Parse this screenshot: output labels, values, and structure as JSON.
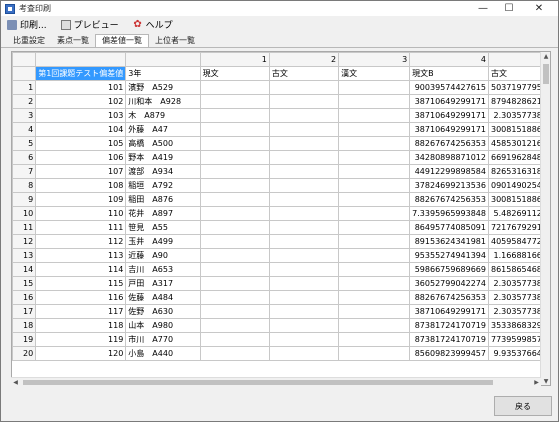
{
  "window": {
    "title": "考査印刷"
  },
  "toolbar": {
    "print_label": "印刷...",
    "preview_label": "プレビュー",
    "help_label": "ヘルプ"
  },
  "tabs": [
    {
      "label": "比重設定"
    },
    {
      "label": "素点一覧"
    },
    {
      "label": "偏差値一覧"
    },
    {
      "label": "上位者一覧"
    }
  ],
  "active_tab_index": 2,
  "grid": {
    "column_numbers": [
      "",
      "1",
      "2",
      "3",
      "4",
      ""
    ],
    "header_row": [
      "第1回課題テスト偏差値",
      "3年",
      "現文",
      "古文",
      "漢文",
      "現文B",
      "古文"
    ],
    "rows": [
      {
        "row": "1",
        "no": "101",
        "name": "濱野　A529",
        "c5": "90039574427615",
        "c6": "50371977951"
      },
      {
        "row": "2",
        "no": "102",
        "name": "川和本　A928",
        "c5": "38710649299171",
        "c6": "87948286216"
      },
      {
        "row": "3",
        "no": "103",
        "name": "木　A879",
        "c5": "38710649299171",
        "c6": "2.303577381"
      },
      {
        "row": "4",
        "no": "104",
        "name": "外藤　A47",
        "c5": "38710649299171",
        "c6": "30081518864"
      },
      {
        "row": "5",
        "no": "105",
        "name": "高橋　A500",
        "c5": "88267674256353",
        "c6": "45853012161"
      },
      {
        "row": "6",
        "no": "106",
        "name": "野本　A419",
        "c5": "34280898871012",
        "c6": "66919628486"
      },
      {
        "row": "7",
        "no": "107",
        "name": "渡部　A934",
        "c5": "44912299898584",
        "c6": "82653163189"
      },
      {
        "row": "8",
        "no": "108",
        "name": "稲垣　A792",
        "c5": "37824699213536",
        "c6": "09014902540"
      },
      {
        "row": "9",
        "no": "109",
        "name": "稲田　A876",
        "c5": "88267674256353",
        "c6": "30081518864"
      },
      {
        "row": "10",
        "no": "110",
        "name": "花井　A897",
        "c5": "7.3395965993848",
        "c6": "5.482691121"
      },
      {
        "row": "11",
        "no": "111",
        "name": "笹見　A55",
        "c5": "86495774085091",
        "c6": "72176792918"
      },
      {
        "row": "12",
        "no": "112",
        "name": "玉井　A499",
        "c5": "89153624341981",
        "c6": "40595847729"
      },
      {
        "row": "13",
        "no": "113",
        "name": "近藤　A90",
        "c5": "95355274941394",
        "c6": "1.166881669"
      },
      {
        "row": "14",
        "no": "114",
        "name": "吉川　A653",
        "c5": "59866759689669",
        "c6": "86158654686"
      },
      {
        "row": "15",
        "no": "115",
        "name": "戸田　A317",
        "c5": "36052799042274",
        "c6": "2.303577381"
      },
      {
        "row": "16",
        "no": "116",
        "name": "佐藤　A484",
        "c5": "88267674256353",
        "c6": "2.303577381"
      },
      {
        "row": "17",
        "no": "117",
        "name": "佐野　A630",
        "c5": "38710649299171",
        "c6": "2.303577381"
      },
      {
        "row": "18",
        "no": "118",
        "name": "山本　A980",
        "c5": "87381724170719",
        "c6": "35338683290"
      },
      {
        "row": "19",
        "no": "119",
        "name": "市川　A770",
        "c5": "87381724170719",
        "c6": "77395998576"
      },
      {
        "row": "20",
        "no": "120",
        "name": "小島　A440",
        "c5": "85609823999457",
        "c6": "9.935376641"
      }
    ]
  },
  "buttons": {
    "back_label": "戻る"
  }
}
